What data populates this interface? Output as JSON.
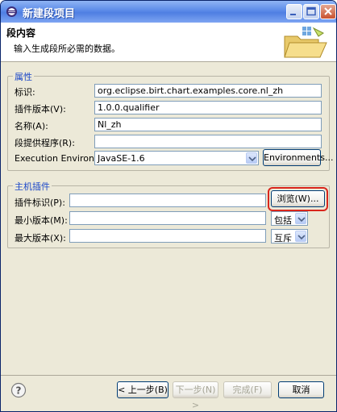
{
  "window": {
    "title": "新建段项目"
  },
  "banner": {
    "title": "段内容",
    "description": "输入生成段所必需的数据。",
    "icon": "folder-wizard-icon"
  },
  "properties": {
    "legend": "属性",
    "id_label": "标识:",
    "id_value": "org.eclipse.birt.chart.examples.core.nl_zh",
    "version_label": "插件版本(V):",
    "version_value": "1.0.0.qualifier",
    "name_label": "名称(A):",
    "name_value": "Nl_zh",
    "provider_label": "段提供程序(R):",
    "provider_value": "",
    "env_label": "Execution Environment:",
    "env_value": "JavaSE-1.6",
    "env_button": "Environments..."
  },
  "host": {
    "legend": "主机插件",
    "plugin_id_label": "插件标识(P):",
    "plugin_id_value": "",
    "browse_button": "浏览(W)...",
    "min_version_label": "最小版本(M):",
    "min_version_value": "",
    "min_inclusive": "包括",
    "max_version_label": "最大版本(X):",
    "max_version_value": "",
    "max_exclusive": "互斥"
  },
  "footer": {
    "back": "< 上一步(B)",
    "next": "下一步(N) >",
    "finish": "完成(F)",
    "cancel": "取消"
  },
  "colors": {
    "legend_text": "#1a46c8",
    "highlight": "#d9261c",
    "titlebar": "#4f7fe2"
  }
}
